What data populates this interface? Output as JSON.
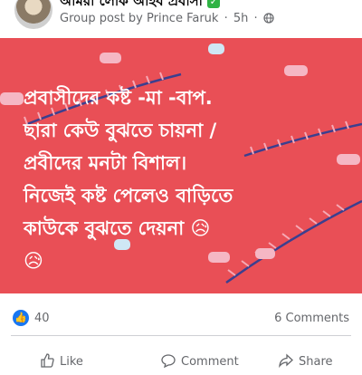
{
  "post": {
    "group_name": "আমরা লোক আইব প্রবাসী",
    "meta_text": "Group post by Prince Faruk",
    "time": "5h",
    "separator": "·",
    "text": "প্রবাসীদের কষ্ট -মা -বাপ.\nছারা কেউ বুঝতে চায়না /\nপ্রবীদের মনটা বিশাল।\nনিজেই কষ্ট পেলেও বাড়িতে\nকাউকে বুঝতে দেয়না 😥\n😥",
    "background_color": "#e94f56"
  },
  "reactions": {
    "count": "40",
    "comments": "6 Comments"
  },
  "actions": {
    "like": "Like",
    "comment": "Comment",
    "share": "Share"
  },
  "colors": {
    "facebook_blue": "#1877f2",
    "meta_gray": "#65676b"
  },
  "icons": [
    "avatar",
    "verified-check-icon",
    "globe-icon",
    "like-reaction-icon",
    "like-icon",
    "comment-icon",
    "share-icon"
  ]
}
